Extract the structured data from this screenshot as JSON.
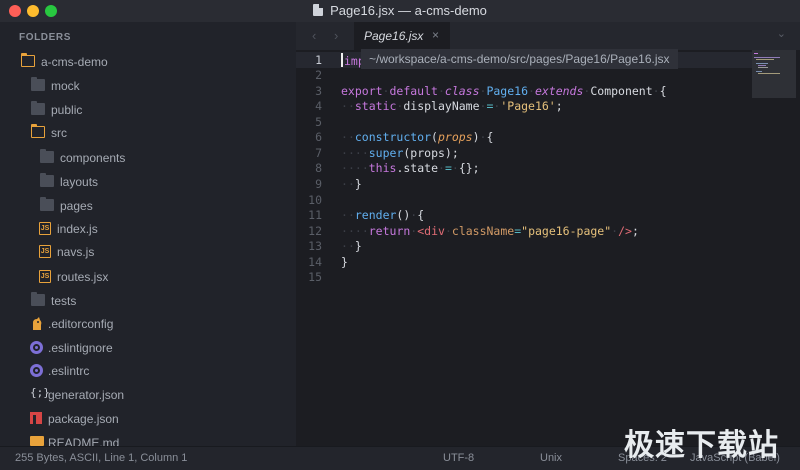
{
  "window": {
    "title": "Page16.jsx — a-cms-demo"
  },
  "sidebar": {
    "heading": "FOLDERS",
    "items": [
      {
        "label": "a-cms-demo",
        "icon": "folder-open-icon",
        "depth": 0
      },
      {
        "label": "mock",
        "icon": "folder-icon",
        "depth": 1
      },
      {
        "label": "public",
        "icon": "folder-icon",
        "depth": 1
      },
      {
        "label": "src",
        "icon": "folder-open-icon",
        "depth": 1
      },
      {
        "label": "components",
        "icon": "folder-icon",
        "depth": 2
      },
      {
        "label": "layouts",
        "icon": "folder-icon",
        "depth": 2
      },
      {
        "label": "pages",
        "icon": "folder-icon",
        "depth": 2
      },
      {
        "label": "index.js",
        "icon": "js-file-icon",
        "depth": 2
      },
      {
        "label": "navs.js",
        "icon": "js-file-icon",
        "depth": 2
      },
      {
        "label": "routes.jsx",
        "icon": "js-file-icon",
        "depth": 2
      },
      {
        "label": "tests",
        "icon": "folder-icon",
        "depth": 1
      },
      {
        "label": ".editorconfig",
        "icon": "editorconfig-icon",
        "depth": 1
      },
      {
        "label": ".eslintignore",
        "icon": "eslint-icon",
        "depth": 1
      },
      {
        "label": ".eslintrc",
        "icon": "eslint-icon",
        "depth": 1
      },
      {
        "label": "generator.json",
        "icon": "json-icon",
        "depth": 1
      },
      {
        "label": "package.json",
        "icon": "npm-icon",
        "depth": 1
      },
      {
        "label": "README.md",
        "icon": "markdown-icon",
        "depth": 1
      }
    ]
  },
  "tabs": [
    {
      "label": "Page16.jsx",
      "active": true,
      "close_glyph": "×"
    }
  ],
  "tab_nav": {
    "back": "‹",
    "forward": "›",
    "overflow": "⌄"
  },
  "tooltip": {
    "path": "~/workspace/a-cms-demo/src/pages/Page16/Page16.jsx"
  },
  "editor": {
    "current_line": 1,
    "line_numbers": [
      "1",
      "2",
      "3",
      "4",
      "5",
      "6",
      "7",
      "8",
      "9",
      "10",
      "11",
      "12",
      "13",
      "14",
      "15"
    ],
    "lines": [
      "import",
      "",
      "export default class Page16 extends Component {",
      "  static displayName = 'Page16';",
      "",
      "  constructor(props) {",
      "    super(props);",
      "    this.state = {};",
      "  }",
      "",
      "  render() {",
      "    return <div className=\"page16-page\" />;",
      "  }",
      "}",
      ""
    ]
  },
  "statusbar": {
    "file_info": "255 Bytes, ASCII, Line 1, Column 1",
    "encoding": "UTF-8",
    "line_endings": "Unix",
    "indentation": "Spaces: 2",
    "syntax": "JavaScript (Babel)"
  },
  "watermark": {
    "text": "极速下载站"
  },
  "colors": {
    "folder_accent": "#e8a23b",
    "keyword": "#c678dd",
    "identifier": "#61afef",
    "string": "#e5c07b",
    "editor_bg": "#1c1d22",
    "sidebar_bg": "#21232a"
  }
}
